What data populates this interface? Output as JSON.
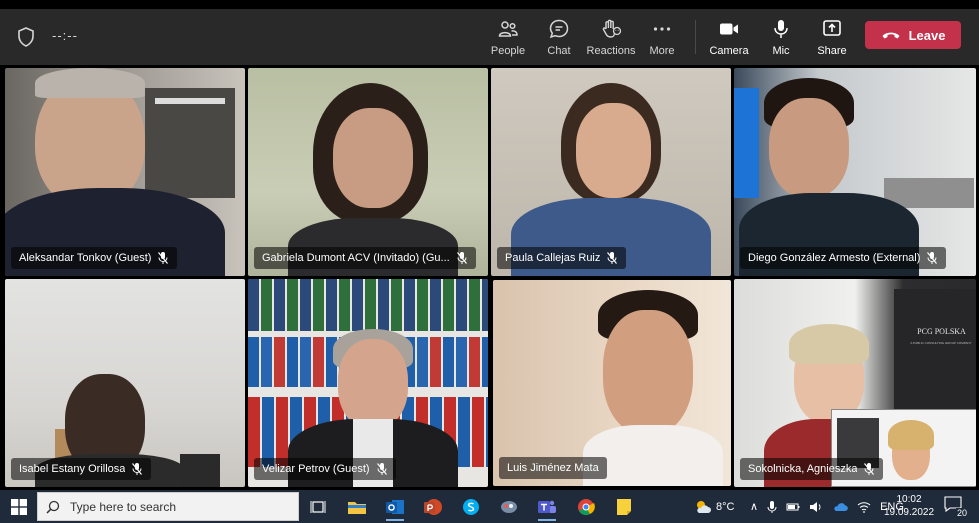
{
  "meeting": {
    "timer": "--:--"
  },
  "toolbar": {
    "people": "People",
    "chat": "Chat",
    "reactions": "Reactions",
    "more": "More",
    "camera": "Camera",
    "mic": "Mic",
    "share": "Share",
    "leave": "Leave"
  },
  "participants": [
    {
      "name": "Aleksandar Tonkov (Guest)",
      "muted": true
    },
    {
      "name": "Gabriela Dumont ACV (Invitado) (Gu...",
      "muted": true
    },
    {
      "name": "Paula Callejas Ruiz",
      "muted": true
    },
    {
      "name": "Diego González Armesto (External)",
      "muted": true
    },
    {
      "name": "Isabel Estany Orillosa",
      "muted": true
    },
    {
      "name": "Velizar Petrov (Guest)",
      "muted": true
    },
    {
      "name": "Luis Jiménez Mata",
      "muted": false,
      "active_speaker": true
    },
    {
      "name": "Sokolnicka, Agnieszka",
      "muted": true
    }
  ],
  "background_text": {
    "logo": "PCG POLSKA",
    "logo_sub": "A PUBLIC CONSULTING GROUP COMPANY"
  },
  "taskbar": {
    "search_placeholder": "Type here to search",
    "temperature": "8°C",
    "language": "ENG",
    "time": "10:02",
    "date": "19.09.2022",
    "notifications": "20"
  },
  "colors": {
    "toolbar_bg": "#292929",
    "leave_red": "#c4314b",
    "active_outline": "#7b83eb",
    "taskbar_bg": "#1f2a3a"
  }
}
